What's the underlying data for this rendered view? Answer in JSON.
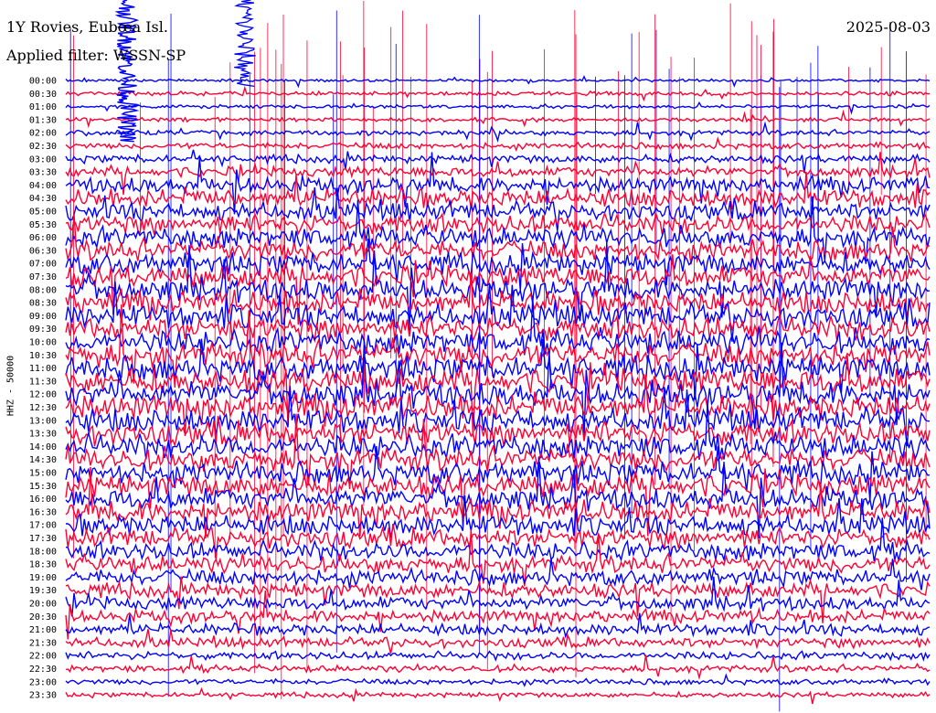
{
  "header": {
    "station": "1Y Rovies, Eubœa Isl.",
    "filter": "Applied filter: WSSN-SP",
    "date": "2025-08-03"
  },
  "chart_data": {
    "type": "line",
    "title": "1Y Rovies, Eubœa Isl.",
    "ylabel": "HHZ - 50000",
    "xlabel": "",
    "row_labels": [
      "00:00",
      "00:30",
      "01:00",
      "01:30",
      "02:00",
      "02:30",
      "03:00",
      "03:30",
      "04:00",
      "04:30",
      "05:00",
      "05:30",
      "06:00",
      "06:30",
      "07:00",
      "07:30",
      "08:00",
      "08:30",
      "09:00",
      "09:30",
      "10:00",
      "10:30",
      "11:00",
      "11:30",
      "12:00",
      "12:30",
      "13:00",
      "13:30",
      "14:00",
      "14:30",
      "15:00",
      "15:30",
      "16:00",
      "16:30",
      "17:00",
      "17:30",
      "18:00",
      "18:30",
      "19:00",
      "19:30",
      "20:00",
      "20:30",
      "21:00",
      "21:30",
      "22:00",
      "22:30",
      "23:00",
      "23:30"
    ],
    "minutes_per_row": 30,
    "trace_colors": [
      "#0000ff",
      "#ff0033"
    ],
    "relative_amplitude_per_row": [
      0.25,
      0.35,
      0.3,
      0.35,
      0.45,
      0.55,
      0.7,
      0.9,
      1.4,
      1.6,
      1.6,
      1.7,
      1.8,
      1.8,
      1.9,
      1.9,
      2.0,
      2.0,
      2.1,
      2.1,
      2.1,
      2.2,
      2.2,
      2.2,
      2.2,
      2.2,
      2.1,
      2.1,
      2.1,
      2.0,
      2.0,
      2.0,
      1.9,
      1.9,
      1.8,
      1.7,
      1.6,
      1.5,
      1.4,
      1.3,
      1.2,
      1.1,
      1.0,
      0.9,
      0.7,
      0.6,
      0.5,
      0.45
    ],
    "event": {
      "start": "00:00",
      "end": "02:30",
      "description": ""
    },
    "grid": false
  }
}
